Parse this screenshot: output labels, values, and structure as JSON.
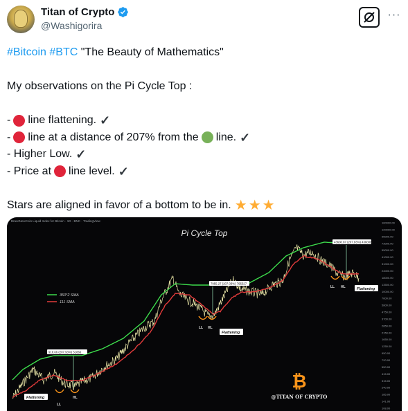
{
  "author": {
    "name": "Titan of Crypto",
    "handle": "@Washigorira",
    "verified": true,
    "avatar_icon": "avatar-image",
    "verified_color": "#1d9bf0"
  },
  "actions": {
    "grok_icon": "grok-icon",
    "more_label": "···"
  },
  "tweet": {
    "line1_tag1": "#Bitcoin",
    "line1_tag2": "#BTC",
    "line1_text": "\"The Beauty of Mathematics\"",
    "line2": "My observations on the Pi Cycle Top :",
    "bullet1_prefix": "-",
    "bullet1_text": "line flattening.",
    "bullet2_prefix": "-",
    "bullet2_mid": "line at a distance of 207% from the",
    "bullet2_end": "line.",
    "bullet3": "- Higher Low.",
    "bullet4_prefix": "- Price at",
    "bullet4_end": "line level.",
    "closing": "Stars are aligned in favor of a bottom to be in.",
    "colors": {
      "red": "#e0243a",
      "green": "#78b159",
      "star": "#ffac33",
      "hashtag": "#1d9bf0"
    }
  },
  "media": {
    "source_text": "BraveNewCoin Liquid Index for Bitcoin · 1D · BNC · TradingView",
    "chart_title": "Pi Cycle Top",
    "legend": [
      {
        "label": "350*2 SMA",
        "color": "#3ddc4c"
      },
      {
        "label": "111 SMA",
        "color": "#e23b3b"
      }
    ],
    "annotations": [
      {
        "text": "Flattening"
      },
      {
        "text": "LL"
      },
      {
        "text": "HL"
      },
      {
        "text": "Flattening"
      },
      {
        "text": "LL"
      },
      {
        "text": "HL"
      },
      {
        "text": "Flattening"
      },
      {
        "text": "LL"
      },
      {
        "text": "HL"
      }
    ],
    "distance_labels": [
      "918.66 (207.93%) 51866",
      "7955.27 (207.03%) 795527",
      "43600.87 (207.93%) 4360087"
    ],
    "watermark": "@TITAN OF CRYPTO",
    "bitcoin_symbol": "₿",
    "y_ticks": [
      "160000.00",
      "120000.00",
      "95000.00",
      "73000.00",
      "55000.00",
      "41000.00",
      "31000.00",
      "24000.00",
      "18000.00",
      "13500.00",
      "10000.00",
      "7600.00",
      "5800.00",
      "4750.00",
      "3700.00",
      "2850.00",
      "2150.00",
      "1650.00",
      "1250.00",
      "950.00",
      "720.00",
      "550.00",
      "415.00",
      "315.00",
      "240.00",
      "185.00",
      "141.00",
      "108.00"
    ],
    "colors": {
      "price": "#e8e4a6",
      "sma350x2": "#3ddc4c",
      "sma111": "#e23b3b",
      "annotation_box": "#ffffff",
      "arrow": "#8fd0a8",
      "bitcoin_orange": "#f7931a"
    }
  }
}
